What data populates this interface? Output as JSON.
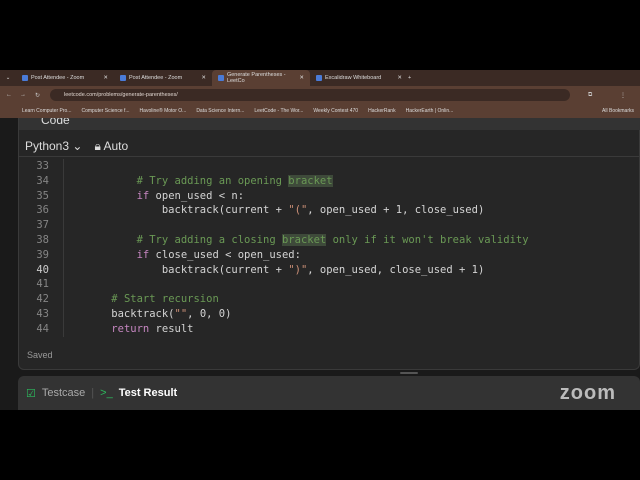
{
  "tabs": [
    {
      "label": "Post Attendee - Zoom",
      "active": false
    },
    {
      "label": "Post Attendee - Zoom",
      "active": false
    },
    {
      "label": "Generate Parentheses - LeetCo",
      "active": true
    },
    {
      "label": "Excalidraw Whiteboard",
      "active": false
    }
  ],
  "url": "leetcode.com/problems/generate-parentheses/",
  "bookmarks": [
    "Learn Computer Pro...",
    "Computer Science f...",
    "Havoline® Motor O...",
    "Data Science Intern...",
    "LeetCode - The Wor...",
    "Weekly Contest 470",
    "HackerRank",
    "HackerEarth | Onlin..."
  ],
  "all_bookmarks": "All Bookmarks",
  "editor": {
    "header": "Code",
    "language": "Python3",
    "mode": "Auto",
    "status": "Saved"
  },
  "code": [
    {
      "n": "33",
      "html": ""
    },
    {
      "n": "34",
      "html": "        <span class='cm'># Try adding an opening <span class='hl'>bracket</span></span>"
    },
    {
      "n": "35",
      "html": "        <span class='kw'>if</span> open_used &lt; n:"
    },
    {
      "n": "36",
      "html": "            backtrack(current + <span class='st'>\"(\"</span>, open_used + 1, close_used)"
    },
    {
      "n": "37",
      "html": ""
    },
    {
      "n": "38",
      "html": "        <span class='cm'># Try adding a closing <span class='hl'>bracket</span> only if it won't break validity</span>"
    },
    {
      "n": "39",
      "html": "        <span class='kw'>if</span> close_used &lt; open_used:"
    },
    {
      "n": "40",
      "html": "            backtrack(current + <span class='st'>\")\"</span>, open_used, close_used + 1)"
    },
    {
      "n": "41",
      "html": ""
    },
    {
      "n": "42",
      "html": "    <span class='cm'># Start recursion</span>"
    },
    {
      "n": "43",
      "html": "    backtrack(<span class='st'>\"\"</span>, 0, 0)"
    },
    {
      "n": "44",
      "html": "    <span class='kw'>return</span> result"
    }
  ],
  "bottom": {
    "testcase": "Testcase",
    "test_result": "Test Result",
    "watermark": "zoom"
  }
}
